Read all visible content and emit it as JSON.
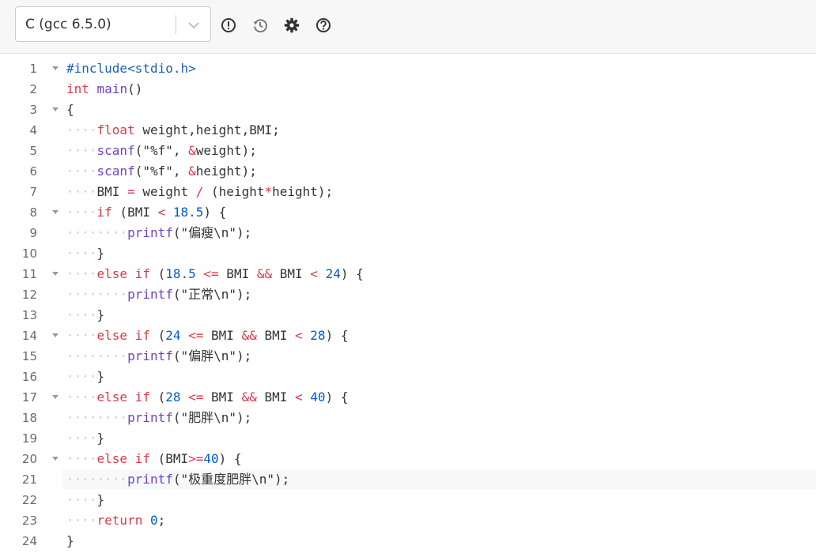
{
  "toolbar": {
    "language": "C (gcc 6.5.0)",
    "icons": [
      "exclamation-icon",
      "history-icon",
      "gear-icon",
      "help-icon"
    ]
  },
  "colors": {
    "keyword": "#d73a49",
    "number": "#005cc5",
    "preprocessor": "#1f5fb4",
    "function": "#6f42c1",
    "text": "#333333",
    "whitespace_dots": "#c9c9c9"
  },
  "editor": {
    "active_line": 21,
    "lines": [
      {
        "n": "1",
        "code": "#include<stdio.h>"
      },
      {
        "n": "2",
        "code": "int main()"
      },
      {
        "n": "3",
        "code": "{"
      },
      {
        "n": "4",
        "code": "    float weight,height,BMI;"
      },
      {
        "n": "5",
        "code": "    scanf(\"%f\", &weight);"
      },
      {
        "n": "6",
        "code": "    scanf(\"%f\", &height);"
      },
      {
        "n": "7",
        "code": "    BMI = weight / (height*height);"
      },
      {
        "n": "8",
        "code": "    if (BMI < 18.5) {"
      },
      {
        "n": "9",
        "code": "        printf(\"偏瘦\\n\");"
      },
      {
        "n": "10",
        "code": "    }"
      },
      {
        "n": "11",
        "code": "    else if (18.5 <= BMI && BMI < 24) {"
      },
      {
        "n": "12",
        "code": "        printf(\"正常\\n\");"
      },
      {
        "n": "13",
        "code": "    }"
      },
      {
        "n": "14",
        "code": "    else if (24 <= BMI && BMI < 28) {"
      },
      {
        "n": "15",
        "code": "        printf(\"偏胖\\n\");"
      },
      {
        "n": "16",
        "code": "    }"
      },
      {
        "n": "17",
        "code": "    else if (28 <= BMI && BMI < 40) {"
      },
      {
        "n": "18",
        "code": "        printf(\"肥胖\\n\");"
      },
      {
        "n": "19",
        "code": "    }"
      },
      {
        "n": "20",
        "code": "    else if (BMI>=40) {"
      },
      {
        "n": "21",
        "code": "        printf(\"极重度肥胖\\n\");"
      },
      {
        "n": "22",
        "code": "    }"
      },
      {
        "n": "23",
        "code": "    return 0;"
      },
      {
        "n": "24",
        "code": "}"
      }
    ]
  }
}
